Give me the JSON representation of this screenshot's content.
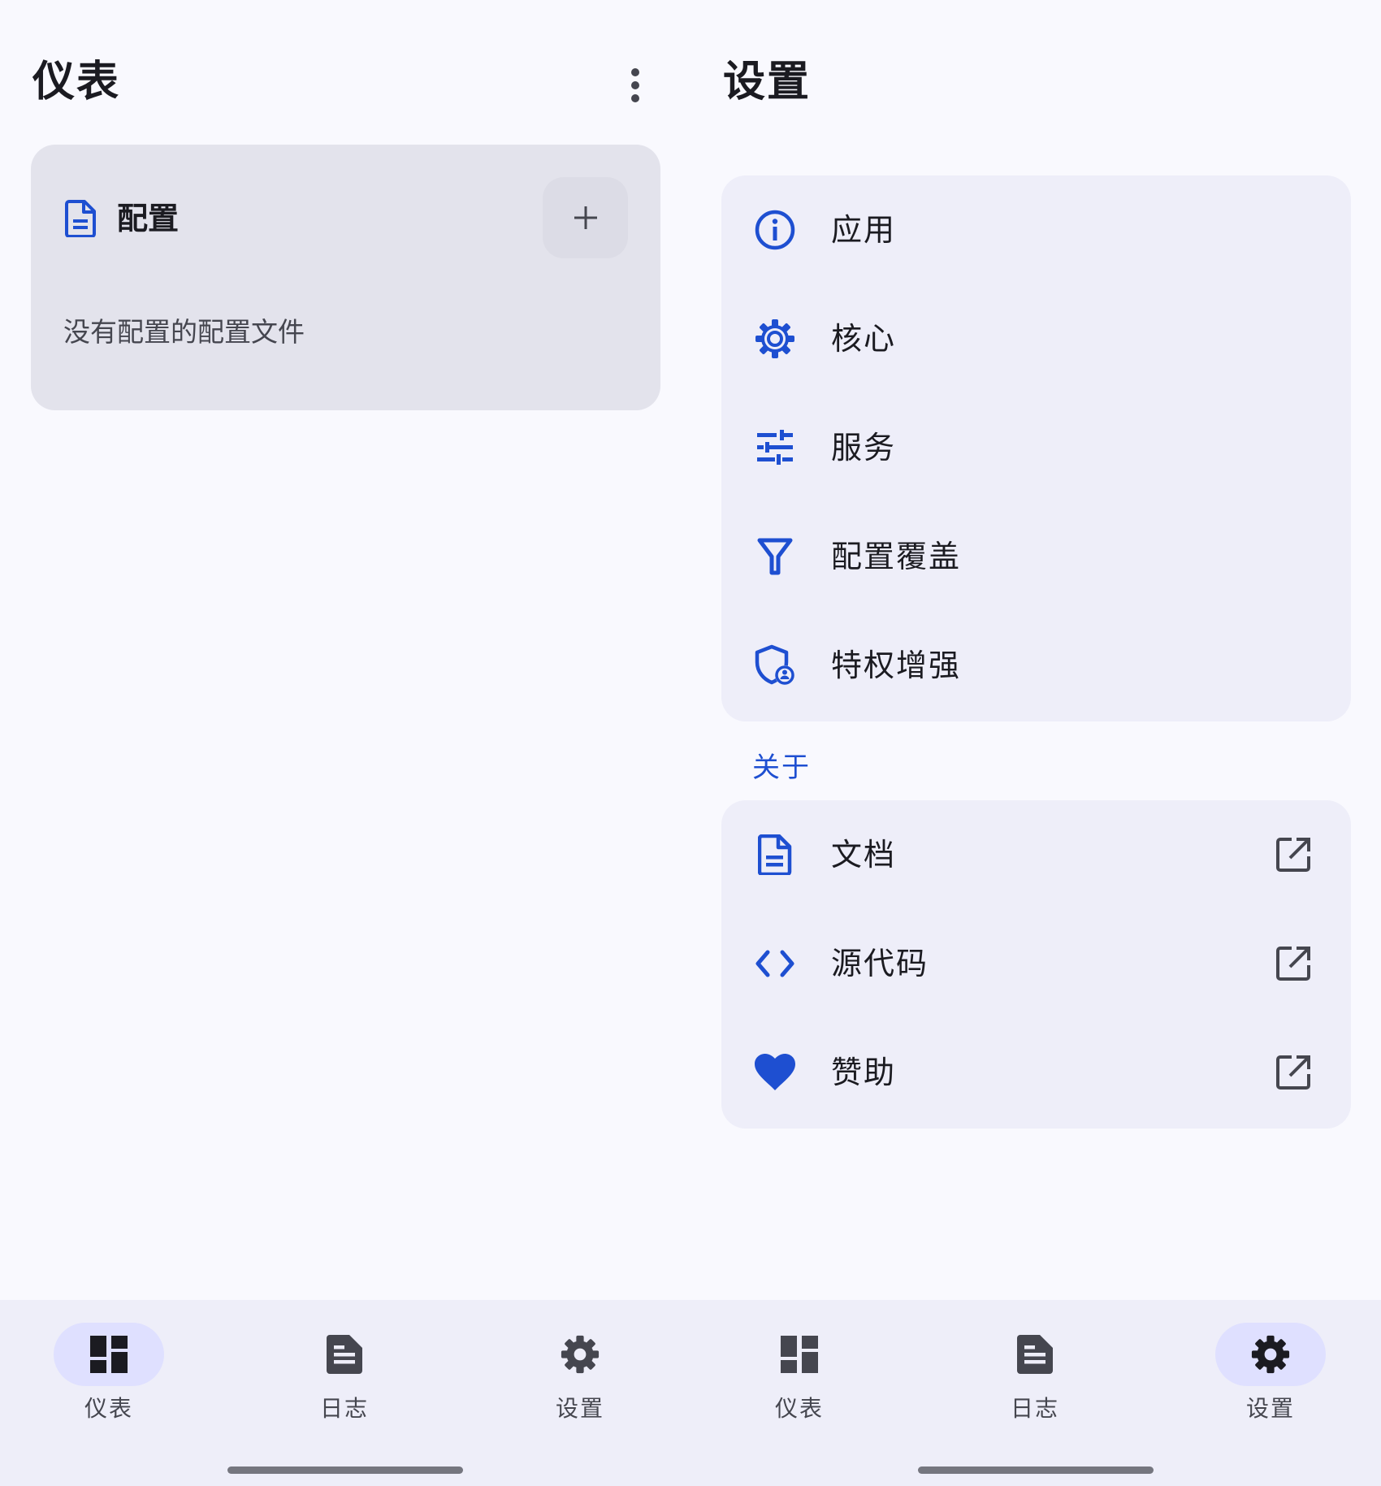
{
  "dashboard": {
    "title": "仪表",
    "profiles_card": {
      "title": "配置",
      "empty_message": "没有配置的配置文件"
    }
  },
  "settings": {
    "title": "设置",
    "main_items": [
      {
        "label": "应用",
        "icon": "info-icon"
      },
      {
        "label": "核心",
        "icon": "gear-icon"
      },
      {
        "label": "服务",
        "icon": "tune-sliders-icon"
      },
      {
        "label": "配置覆盖",
        "icon": "filter-icon"
      },
      {
        "label": "特权增强",
        "icon": "admin-shield-icon"
      }
    ],
    "about_label": "关于",
    "about_items": [
      {
        "label": "文档",
        "icon": "document-icon"
      },
      {
        "label": "源代码",
        "icon": "code-icon"
      },
      {
        "label": "赞助",
        "icon": "heart-icon"
      }
    ]
  },
  "bottom_nav": {
    "left": [
      {
        "label": "仪表",
        "icon": "dashboard-icon",
        "active": true
      },
      {
        "label": "日志",
        "icon": "log-icon",
        "active": false
      },
      {
        "label": "设置",
        "icon": "settings-icon",
        "active": false
      }
    ],
    "right": [
      {
        "label": "仪表",
        "icon": "dashboard-icon",
        "active": false
      },
      {
        "label": "日志",
        "icon": "log-icon",
        "active": false
      },
      {
        "label": "设置",
        "icon": "settings-icon",
        "active": true
      }
    ]
  },
  "colors": {
    "accent": "#1e4fd1",
    "background": "#f9f9fe",
    "card": "#e3e3ec",
    "group": "#eeeef9",
    "nav_active": "#dfe0ff"
  }
}
